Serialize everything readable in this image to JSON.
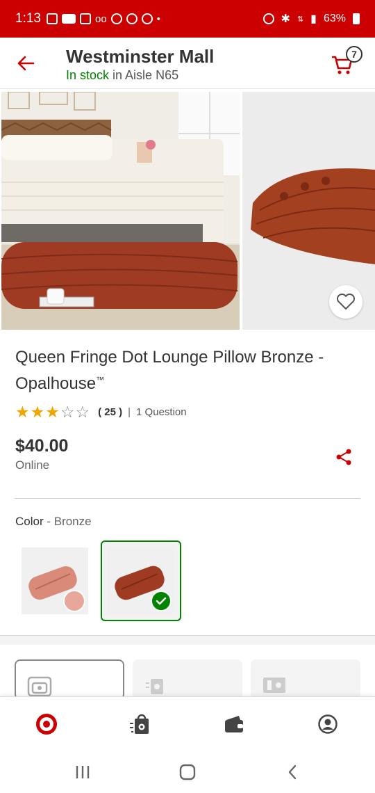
{
  "status_bar": {
    "time": "1:13",
    "battery": "63%",
    "left_icons": [
      "instagram-icon",
      "ring-icon",
      "news-icon",
      "voicemail-icon",
      "tag-icon",
      "tag-icon",
      "target-icon",
      "dot-icon"
    ],
    "right_icons": [
      "alarm-icon",
      "bluetooth-icon",
      "data-icon",
      "signal-icon",
      "battery-icon"
    ]
  },
  "header": {
    "store_name": "Westminster Mall",
    "stock_status": "In stock",
    "stock_location": " in Aisle N65",
    "cart_count": "7"
  },
  "product": {
    "title": "Queen Fringe Dot Lounge Pillow Bronze - Opalhouse",
    "trademark": "™",
    "rating": 3,
    "rating_max": 5,
    "review_count": "( 25 )",
    "separator": "|",
    "questions": "1 Question",
    "price": "$40.00",
    "price_channel": "Online",
    "color_label": "Color",
    "color_value": " - Bronze",
    "swatches": [
      {
        "name": "Blush",
        "selected": false
      },
      {
        "name": "Bronze",
        "selected": true
      }
    ]
  },
  "colors": {
    "brand_red": "#cc0000",
    "in_stock_green": "#008300",
    "star": "#f0a500",
    "pillow_bronze": "#9e3b22",
    "pillow_blush": "#d98a78"
  },
  "bottom_nav": [
    "target-home-icon",
    "shopping-bag-icon",
    "wallet-icon",
    "account-icon"
  ],
  "system_nav": [
    "recents-icon",
    "home-icon",
    "back-icon"
  ]
}
